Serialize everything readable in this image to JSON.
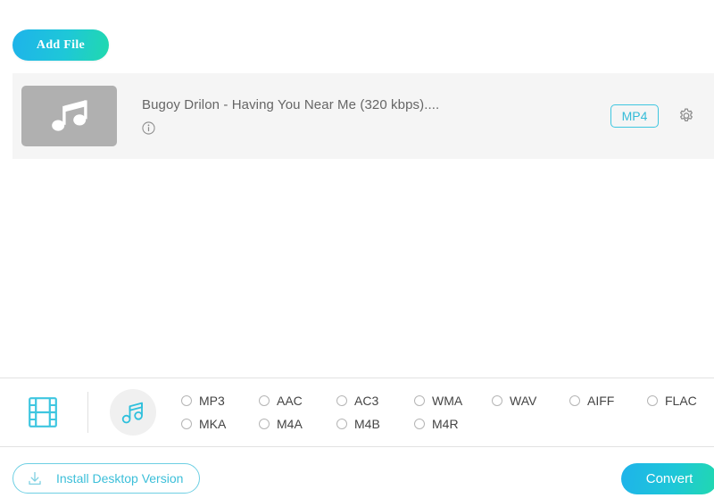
{
  "toolbar": {
    "add_file_label": "Add File"
  },
  "file_list": {
    "items": [
      {
        "title": "Bugoy Drilon - Having You Near Me (320 kbps)....",
        "thumbnail_icon": "music-note-icon",
        "info_icon": "info-icon",
        "output_format": "MP4",
        "settings_icon": "gear-icon"
      }
    ]
  },
  "format_bar": {
    "tabs": [
      {
        "id": "video",
        "icon": "film-strip-icon",
        "active": false
      },
      {
        "id": "audio",
        "icon": "music-note-icon",
        "active": true
      }
    ],
    "formats": [
      {
        "label": "MP3",
        "selected": false
      },
      {
        "label": "AAC",
        "selected": false
      },
      {
        "label": "AC3",
        "selected": false
      },
      {
        "label": "WMA",
        "selected": false
      },
      {
        "label": "WAV",
        "selected": false
      },
      {
        "label": "AIFF",
        "selected": false
      },
      {
        "label": "FLAC",
        "selected": false
      },
      {
        "label": "MKA",
        "selected": false
      },
      {
        "label": "M4A",
        "selected": false
      },
      {
        "label": "M4B",
        "selected": false
      },
      {
        "label": "M4R",
        "selected": false
      }
    ]
  },
  "bottom_bar": {
    "install_label": "Install Desktop Version",
    "install_icon": "download-icon",
    "convert_label": "Convert"
  },
  "colors": {
    "accent_start": "#1eb3ea",
    "accent_end": "#21d9ae",
    "accent_cyan": "#35bcd8",
    "row_background": "#f5f5f5",
    "thumbnail_gray": "#b0b0b0"
  }
}
